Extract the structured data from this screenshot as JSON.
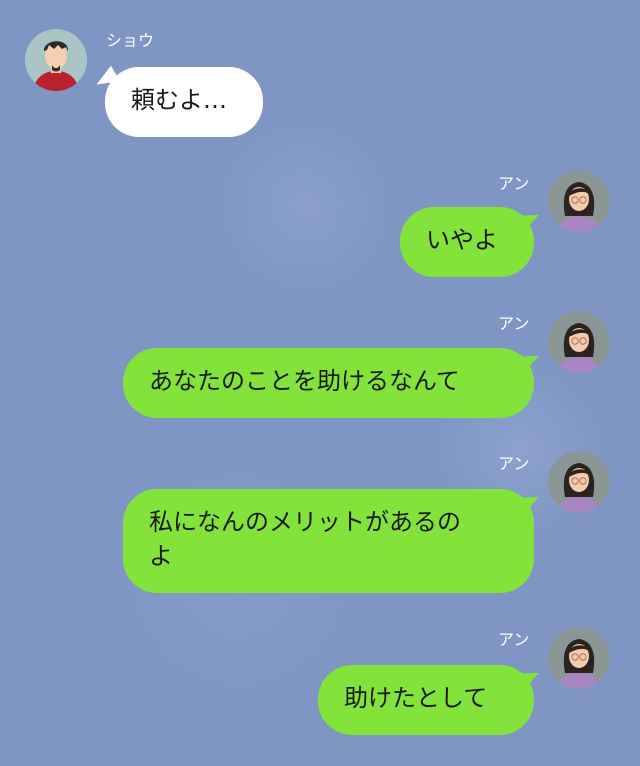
{
  "colors": {
    "background": "#7f95c3",
    "incoming_bubble": "#ffffff",
    "outgoing_bubble": "#84e33b"
  },
  "messages": [
    {
      "sender": "ショウ",
      "side": "left",
      "avatar": "man-avatar-icon",
      "lines": [
        "頼むよ…"
      ]
    },
    {
      "sender": "アン",
      "side": "right",
      "avatar": "woman-avatar-icon",
      "lines": [
        "いやよ"
      ]
    },
    {
      "sender": "アン",
      "side": "right",
      "avatar": "woman-avatar-icon",
      "lines": [
        "あなたのことを助けるなんて"
      ]
    },
    {
      "sender": "アン",
      "side": "right",
      "avatar": "woman-avatar-icon",
      "lines": [
        "私になんのメリットがあるの",
        "よ"
      ]
    },
    {
      "sender": "アン",
      "side": "right",
      "avatar": "woman-avatar-icon",
      "lines": [
        "助けたとして"
      ]
    }
  ]
}
